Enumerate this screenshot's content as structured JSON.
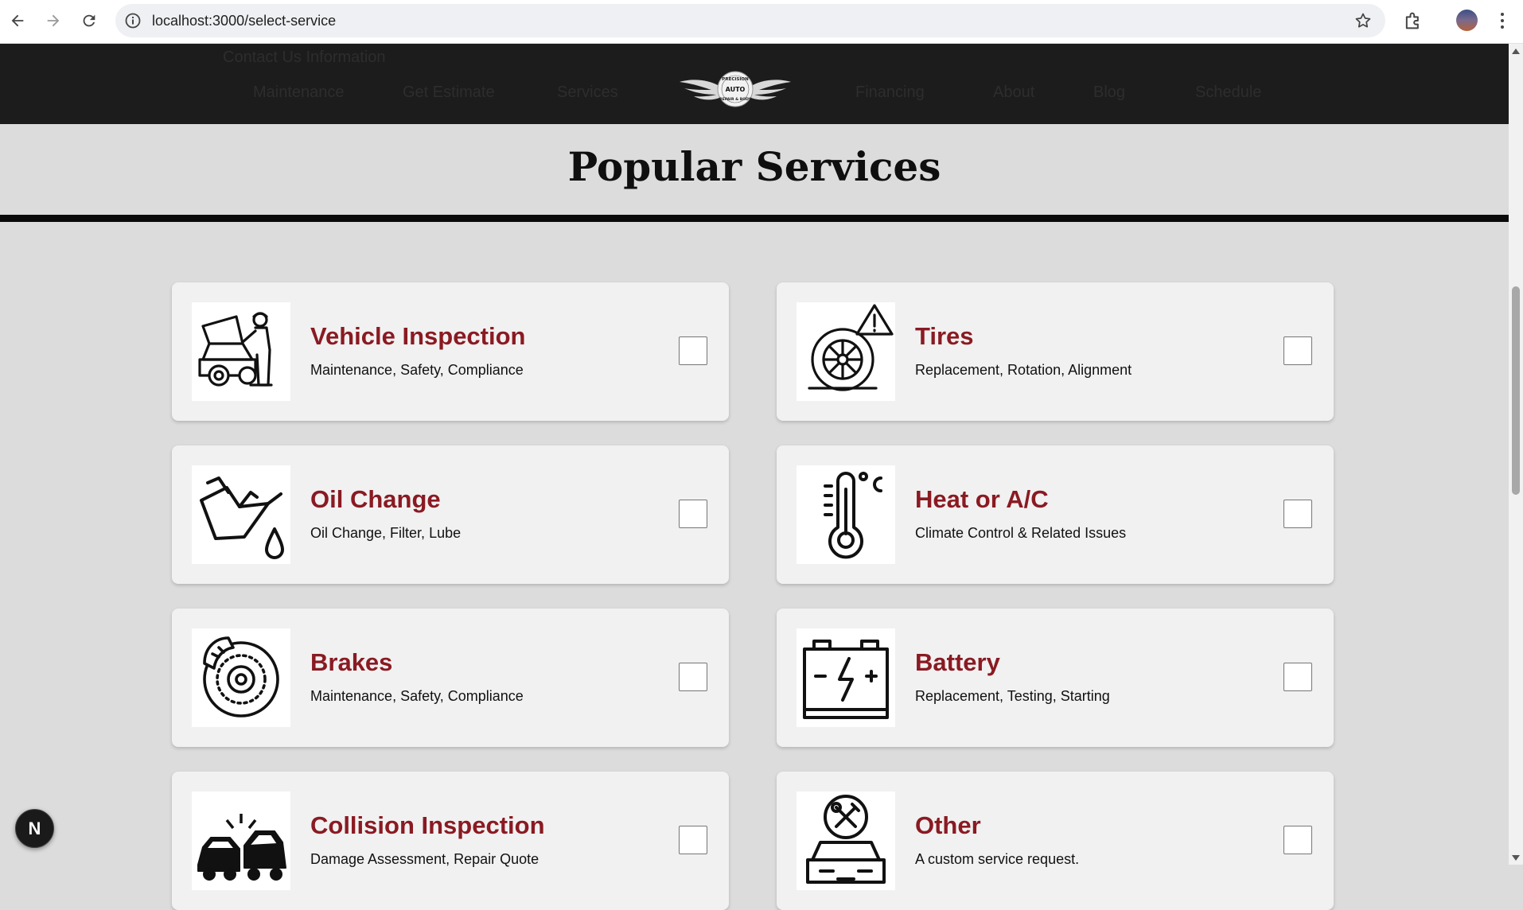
{
  "browser": {
    "url": "localhost:3000/select-service"
  },
  "header": {
    "top_text": "Contact Us Information",
    "nav_left": [
      "Maintenance",
      "Get Estimate",
      "Services"
    ],
    "nav_right": [
      "Financing",
      "About",
      "Blog",
      "Schedule"
    ],
    "logo_text": [
      "PRECISION",
      "AUTO",
      "REPAIR & BODY"
    ]
  },
  "page": {
    "title": "Popular Services"
  },
  "services": [
    {
      "title": "Vehicle Inspection",
      "subtitle": "Maintenance, Safety, Compliance",
      "icon": "mechanic-icon",
      "checked": false
    },
    {
      "title": "Tires",
      "subtitle": "Replacement, Rotation, Alignment",
      "icon": "tire-warning-icon",
      "checked": false
    },
    {
      "title": "Oil Change",
      "subtitle": "Oil Change, Filter, Lube",
      "icon": "oil-can-icon",
      "checked": false
    },
    {
      "title": "Heat or A/C",
      "subtitle": "Climate Control & Related Issues",
      "icon": "thermometer-icon",
      "checked": false
    },
    {
      "title": "Brakes",
      "subtitle": "Maintenance, Safety, Compliance",
      "icon": "brake-disc-icon",
      "checked": false
    },
    {
      "title": "Battery",
      "subtitle": "Replacement, Testing, Starting",
      "icon": "battery-icon",
      "checked": false
    },
    {
      "title": "Collision Inspection",
      "subtitle": "Damage Assessment, Repair Quote",
      "icon": "collision-icon",
      "checked": false
    },
    {
      "title": "Other",
      "subtitle": "A custom service request.",
      "icon": "custom-service-icon",
      "checked": false
    }
  ],
  "dev_badge": {
    "label": "N"
  },
  "colors": {
    "service_title": "#8a1a22",
    "header_bg": "#1c1c1c",
    "page_bg": "#dcdcdc",
    "card_bg": "#f1f1f1"
  }
}
